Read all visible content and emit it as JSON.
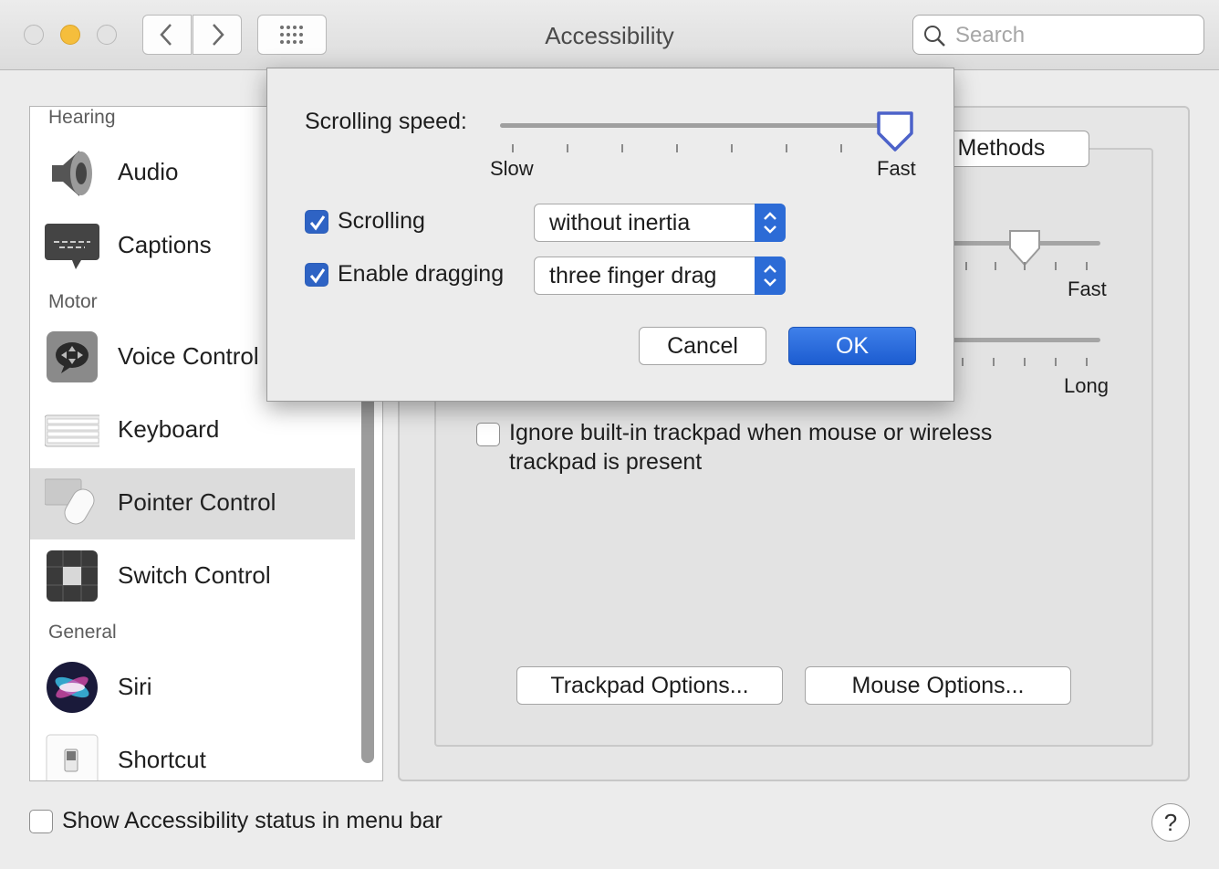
{
  "window": {
    "title": "Accessibility",
    "search_placeholder": "Search"
  },
  "sidebar": {
    "sections": {
      "hearing": "Hearing",
      "motor": "Motor",
      "general": "General"
    },
    "items": [
      {
        "label": "Audio",
        "icon": "speaker-icon"
      },
      {
        "label": "Captions",
        "icon": "captions-icon"
      },
      {
        "label": "Voice Control",
        "icon": "voice-control-icon"
      },
      {
        "label": "Keyboard",
        "icon": "keyboard-icon"
      },
      {
        "label": "Pointer Control",
        "icon": "pointer-control-icon",
        "selected": true
      },
      {
        "label": "Switch Control",
        "icon": "switch-control-icon"
      },
      {
        "label": "Siri",
        "icon": "siri-icon"
      },
      {
        "label": "Shortcut",
        "icon": "shortcut-icon"
      }
    ]
  },
  "pane": {
    "tab_fragment": "l Methods",
    "slider1_right_label": "Fast",
    "slider2_right_label": "Long",
    "ignore_trackpad_line1": "Ignore built-in trackpad when mouse or wireless",
    "ignore_trackpad_line2": "trackpad is present",
    "ignore_trackpad_checked": false,
    "trackpad_options_label": "Trackpad Options...",
    "mouse_options_label": "Mouse Options..."
  },
  "dialog": {
    "scrolling_speed_label": "Scrolling speed:",
    "scrolling_speed_level": 1.0,
    "slow_label": "Slow",
    "fast_label": "Fast",
    "scrolling_label": "Scrolling",
    "scrolling_checked": true,
    "scrolling_value": "without inertia",
    "dragging_label": "Enable dragging",
    "dragging_checked": true,
    "dragging_value": "three finger drag",
    "cancel_label": "Cancel",
    "ok_label": "OK"
  },
  "footer": {
    "status_menu_label": "Show Accessibility status in menu bar",
    "status_menu_checked": false,
    "help_label": "?"
  },
  "colors": {
    "accent": "#2e63c4",
    "window_bg": "#ececec"
  }
}
